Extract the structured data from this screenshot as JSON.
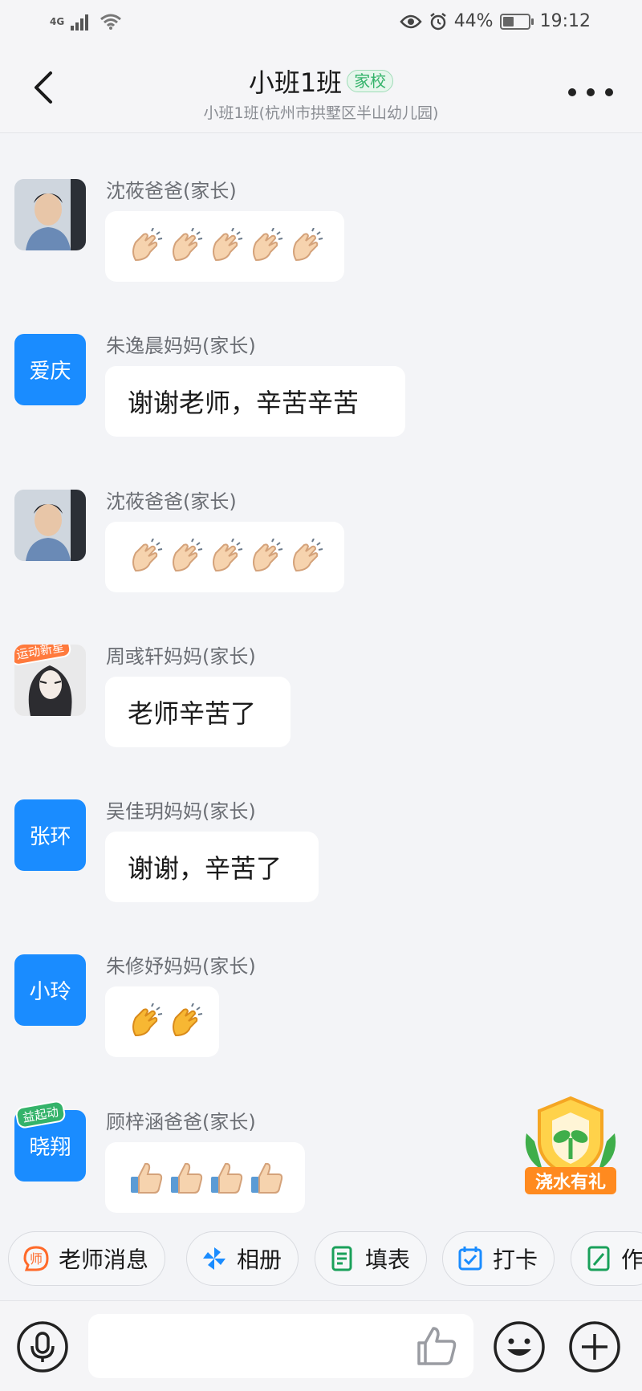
{
  "status_bar": {
    "network": "4G",
    "battery": "44%",
    "battery_level": 0.44,
    "time": "19:12"
  },
  "header": {
    "title": "小班1班",
    "tag": "家校",
    "subtitle": "小班1班(杭州市拱墅区半山幼儿园)"
  },
  "messages": [
    {
      "sender": "沈莜爸爸(家长)",
      "avatar_type": "photo",
      "content_type": "emoji",
      "emoji": "clapping-hands",
      "emoji_count": 5
    },
    {
      "sender": "朱逸晨妈妈(家长)",
      "avatar_text": "爱庆",
      "content_type": "text",
      "text": "谢谢老师，辛苦辛苦"
    },
    {
      "sender": "沈莜爸爸(家长)",
      "avatar_type": "photo",
      "content_type": "emoji",
      "emoji": "clapping-hands",
      "emoji_count": 5
    },
    {
      "sender": "周彧轩妈妈(家长)",
      "avatar_type": "illustration",
      "avatar_badge": "运动新星",
      "content_type": "text",
      "text": "老师辛苦了"
    },
    {
      "sender": "吴佳玥妈妈(家长)",
      "avatar_text": "张环",
      "content_type": "text",
      "text": "谢谢，辛苦了"
    },
    {
      "sender": "朱修妤妈妈(家长)",
      "avatar_text": "小玲",
      "content_type": "emoji",
      "emoji": "clapping-hands-yellow",
      "emoji_count": 2
    },
    {
      "sender": "顾梓涵爸爸(家长)",
      "avatar_text": "晓翔",
      "avatar_badge": "益起动",
      "content_type": "emoji",
      "emoji": "thumbs-up",
      "emoji_count": 4
    }
  ],
  "promo": {
    "label": "浇水有礼"
  },
  "quick_actions": [
    {
      "label": "老师消息",
      "icon": "teacher-icon",
      "color": "#ff6a2a"
    },
    {
      "label": "相册",
      "icon": "pinwheel-icon",
      "color": "#1a8cff"
    },
    {
      "label": "填表",
      "icon": "form-icon",
      "color": "#1aa05a"
    },
    {
      "label": "打卡",
      "icon": "calendar-check-icon",
      "color": "#1a8cff"
    },
    {
      "label": "作",
      "icon": "notebook-icon",
      "color": "#1aa05a"
    }
  ],
  "input_bar": {
    "placeholder": "",
    "icons": [
      "microphone-icon",
      "thumbs-up-icon",
      "smiley-icon",
      "plus-icon"
    ]
  },
  "colors": {
    "accent_blue": "#1a8cff",
    "tag_green": "#34b36a",
    "promo_orange": "#ff8a1f",
    "background": "#f3f4f7"
  }
}
